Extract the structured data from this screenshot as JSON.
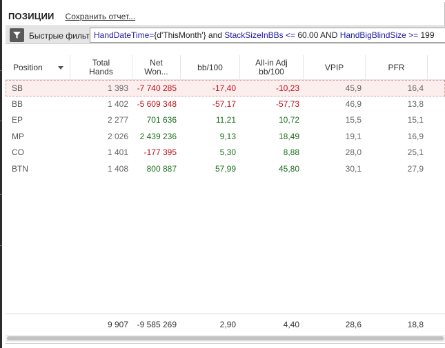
{
  "header": {
    "title": "ПОЗИЦИИ",
    "save_report": "Сохранить отчет..."
  },
  "filter": {
    "label": "Быстрые фильт",
    "tokens": [
      {
        "t": "HandDateTime",
        "k": "kw"
      },
      {
        "t": "=",
        "k": "op"
      },
      {
        "t": "{d'ThisMonth'}",
        "k": "str"
      },
      {
        "t": " and ",
        "k": "txt"
      },
      {
        "t": "StackSizeInBBs",
        "k": "kw"
      },
      {
        "t": " <= ",
        "k": "op"
      },
      {
        "t": "60.00",
        "k": "txt"
      },
      {
        "t": " AND ",
        "k": "txt"
      },
      {
        "t": "HandBigBlindSize",
        "k": "kw"
      },
      {
        "t": " >= ",
        "k": "op"
      },
      {
        "t": "199",
        "k": "txt"
      }
    ]
  },
  "columns": [
    {
      "label": "Position"
    },
    {
      "label": "Total\nHands"
    },
    {
      "label": "Net\nWon..."
    },
    {
      "label": "bb/100"
    },
    {
      "label": "All-in Adj\nbb/100"
    },
    {
      "label": "VPIP"
    },
    {
      "label": "PFR"
    }
  ],
  "rows": [
    {
      "position": "SB",
      "hands": "1 393",
      "net": "-7 740 285",
      "bb100": "-17,40",
      "allin": "-10,23",
      "vpip": "45,9",
      "pfr": "16,4",
      "selected": true
    },
    {
      "position": "BB",
      "hands": "1 402",
      "net": "-5 609 348",
      "bb100": "-57,17",
      "allin": "-57,73",
      "vpip": "46,9",
      "pfr": "13,8"
    },
    {
      "position": "EP",
      "hands": "2 277",
      "net": "701 636",
      "bb100": "11,21",
      "allin": "10,72",
      "vpip": "15,5",
      "pfr": "15,1"
    },
    {
      "position": "MP",
      "hands": "2 026",
      "net": "2 439 236",
      "bb100": "9,13",
      "allin": "18,49",
      "vpip": "19,1",
      "pfr": "16,9"
    },
    {
      "position": "CO",
      "hands": "1 401",
      "net": "-177 395",
      "bb100": "5,30",
      "allin": "8,88",
      "vpip": "28,0",
      "pfr": "25,1"
    },
    {
      "position": "BTN",
      "hands": "1 408",
      "net": "800 887",
      "bb100": "57,99",
      "allin": "45,80",
      "vpip": "30,1",
      "pfr": "27,9"
    }
  ],
  "totals": {
    "hands": "9 907",
    "net": "-9 585 269",
    "bb100": "2,90",
    "allin": "4,40",
    "vpip": "28,6",
    "pfr": "18,8"
  },
  "colors": {
    "negative": "#c0101a",
    "positive": "#1e6e1e",
    "keyword": "#1a1aa6"
  }
}
